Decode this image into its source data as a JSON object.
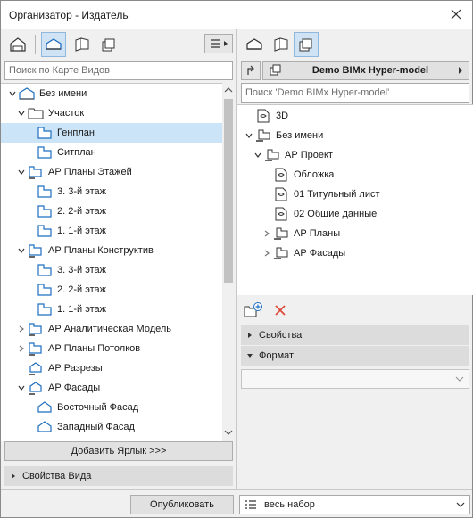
{
  "window": {
    "title": "Организатор - Издатель"
  },
  "left": {
    "search_placeholder": "Поиск по Карте Видов",
    "tree": [
      {
        "label": "Без имени"
      },
      {
        "label": "Участок"
      },
      {
        "label": "Генплан"
      },
      {
        "label": "Ситплан"
      },
      {
        "label": "АР Планы Этажей"
      },
      {
        "label": "3. 3-й этаж"
      },
      {
        "label": "2. 2-й этаж"
      },
      {
        "label": "1. 1-й этаж"
      },
      {
        "label": "АР Планы Конструктив"
      },
      {
        "label": "3. 3-й этаж"
      },
      {
        "label": "2. 2-й этаж"
      },
      {
        "label": "1. 1-й этаж"
      },
      {
        "label": "АР Аналитическая Модель"
      },
      {
        "label": "АР Планы Потолков"
      },
      {
        "label": "АР Разрезы"
      },
      {
        "label": "АР Фасады"
      },
      {
        "label": "Восточный Фасад"
      },
      {
        "label": "Западный Фасад"
      }
    ],
    "add_shortcut_label": "Добавить Ярлык >>>",
    "view_properties_label": "Свойства Вида"
  },
  "right": {
    "publisher_set": "Demo BIMx Hyper-model",
    "search_placeholder": "Поиск 'Demo BIMx Hyper-model'",
    "tree": [
      {
        "label": "3D"
      },
      {
        "label": "Без имени"
      },
      {
        "label": "АР Проект"
      },
      {
        "label": "Обложка"
      },
      {
        "label": "01 Титульный лист"
      },
      {
        "label": "02 Общие данные"
      },
      {
        "label": "АР Планы"
      },
      {
        "label": "АР Фасады"
      }
    ],
    "properties_label": "Свойства",
    "format_label": "Формат",
    "format_value": ""
  },
  "bottom": {
    "publish_label": "Опубликовать",
    "set_value": "весь набор"
  },
  "colors": {
    "accent_blue": "#1f6fc0",
    "selection": "#cce4f7",
    "delete_red": "#e04a3a"
  }
}
